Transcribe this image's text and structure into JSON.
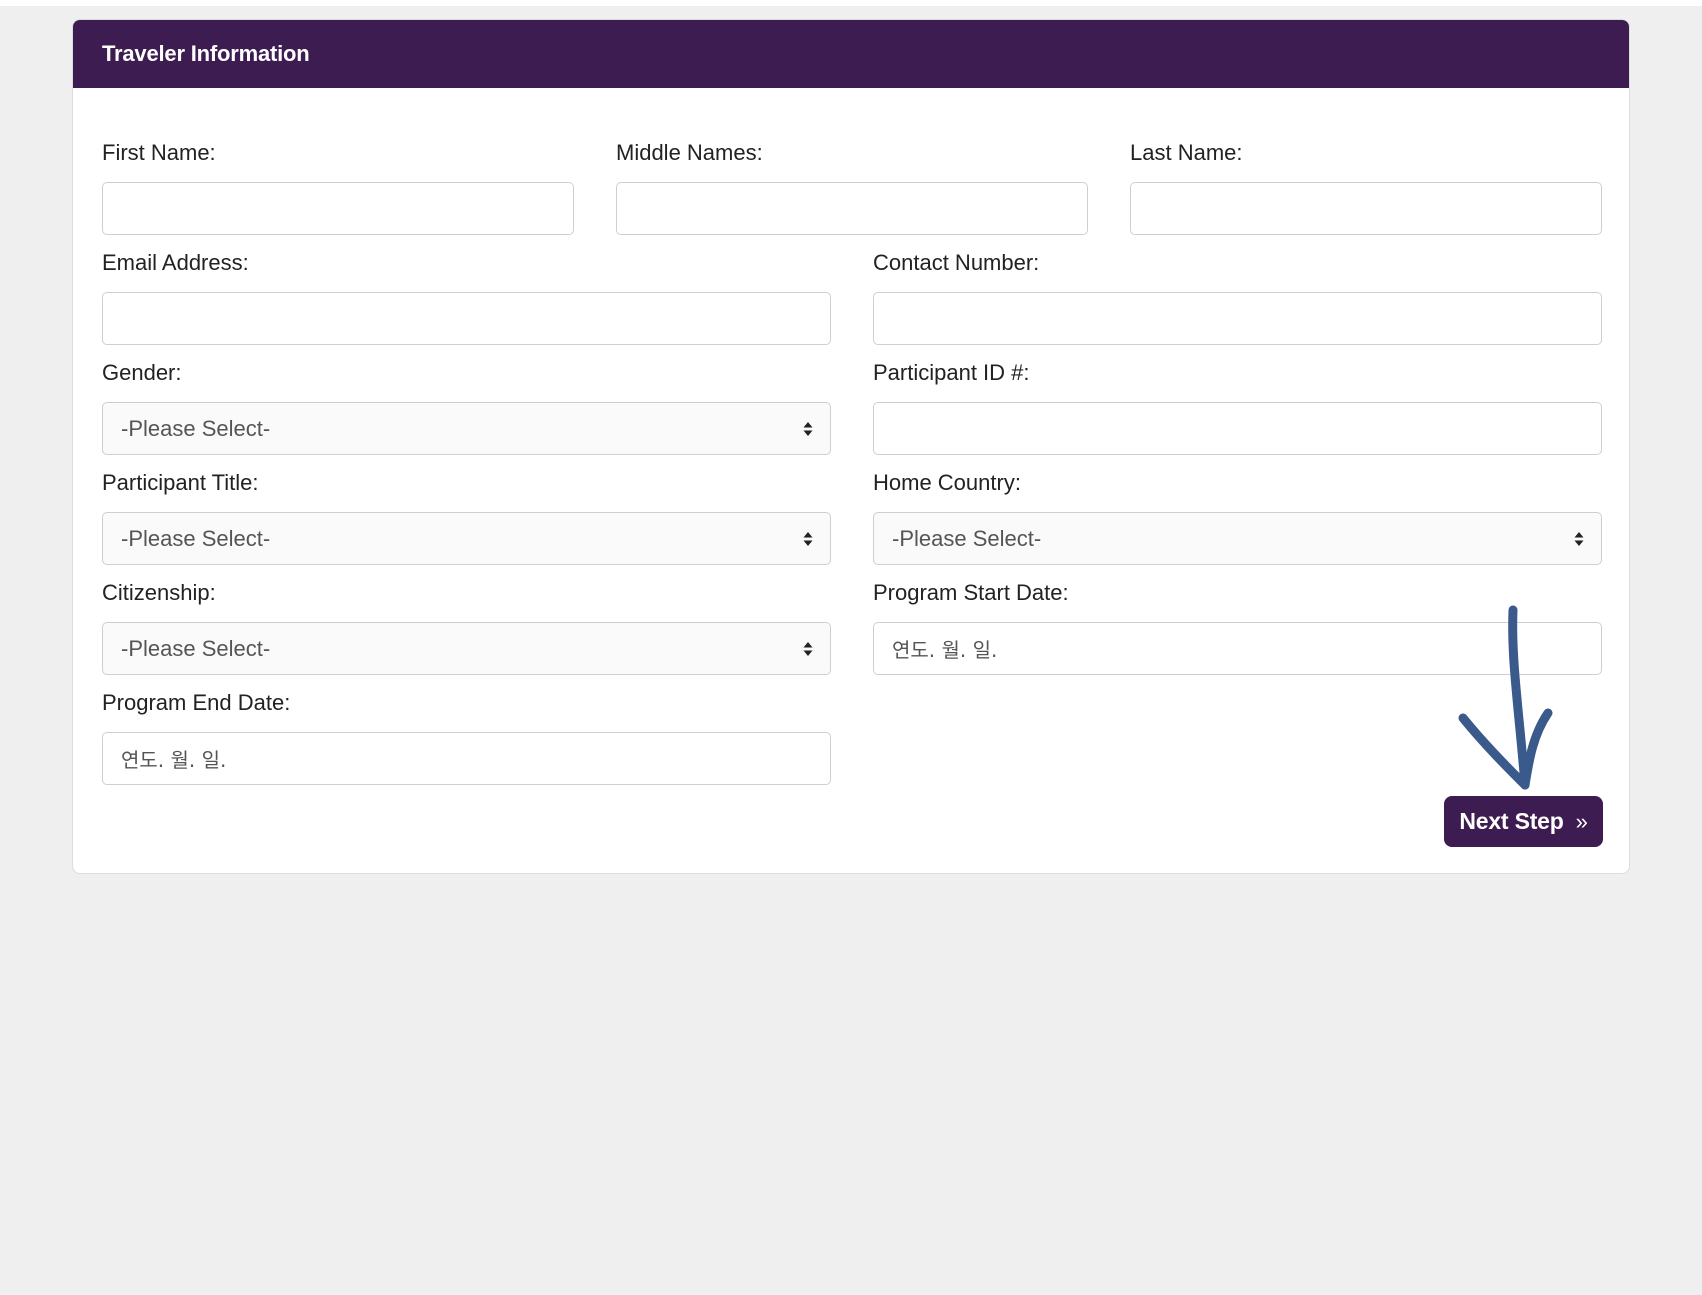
{
  "form": {
    "title": "Traveler Information",
    "fields": {
      "first_name": {
        "label": "First Name:",
        "value": ""
      },
      "middle_names": {
        "label": "Middle Names:",
        "value": ""
      },
      "last_name": {
        "label": "Last Name:",
        "value": ""
      },
      "email": {
        "label": "Email Address:",
        "value": ""
      },
      "contact_number": {
        "label": "Contact Number:",
        "value": ""
      },
      "gender": {
        "label": "Gender:",
        "selected": "-Please Select-"
      },
      "participant_id": {
        "label": "Participant ID #:",
        "value": ""
      },
      "participant_title": {
        "label": "Participant Title:",
        "selected": "-Please Select-"
      },
      "home_country": {
        "label": "Home Country:",
        "selected": "-Please Select-"
      },
      "citizenship": {
        "label": "Citizenship:",
        "selected": "-Please Select-"
      },
      "program_start_date": {
        "label": "Program Start Date:",
        "placeholder": "연도. 월. 일."
      },
      "program_end_date": {
        "label": "Program End Date:",
        "placeholder": "연도. 월. 일."
      }
    },
    "next_button": {
      "label": "Next Step",
      "icon": "double-chevron-right-icon",
      "icon_glyph": "»"
    }
  },
  "colors": {
    "header_bg": "#3d1c51",
    "button_bg": "#3d1c51",
    "annotation_arrow": "#3a5a8c",
    "page_bg": "#efefef"
  }
}
